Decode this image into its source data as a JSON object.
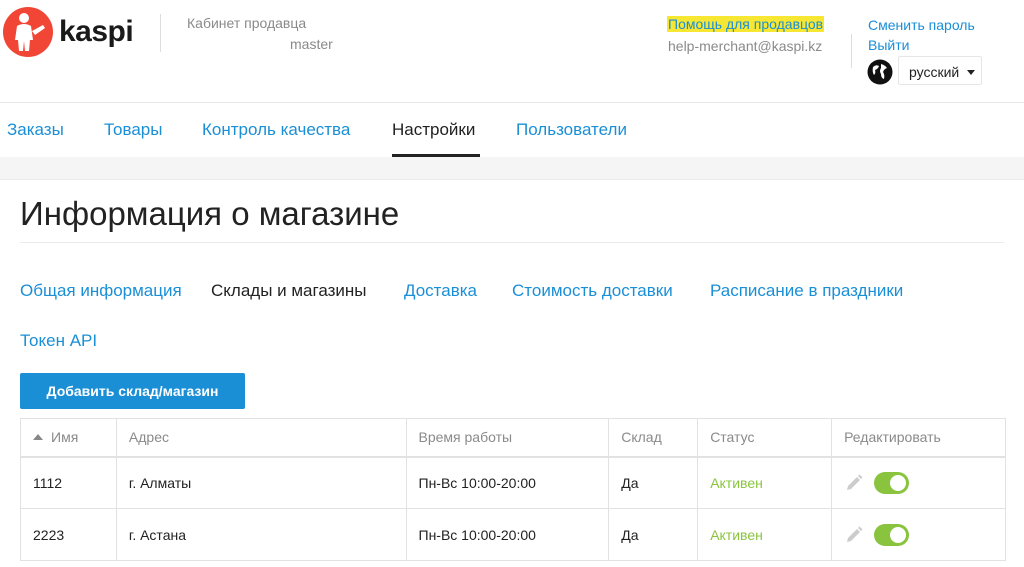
{
  "brand": {
    "name": "kaspi",
    "accent": "#f14635",
    "link_color": "#1a8fd6",
    "active_status_color": "#8ac43f"
  },
  "header": {
    "cabinet_title": "Кабинет продавца",
    "cabinet_user": "master",
    "help_link": "Помощь для продавцов",
    "help_email": "help-merchant@kaspi.kz",
    "change_password": "Сменить пароль",
    "logout": "Выйти",
    "language": "русский",
    "globe_icon": "globe-icon"
  },
  "nav": {
    "items": [
      {
        "label": "Заказы"
      },
      {
        "label": "Товары"
      },
      {
        "label": "Контроль качества"
      },
      {
        "label": "Настройки"
      },
      {
        "label": "Пользователи"
      }
    ],
    "active": "Настройки"
  },
  "page": {
    "title": "Информация о магазине",
    "subtabs": [
      {
        "label": "Общая информация"
      },
      {
        "label": "Склады и магазины"
      },
      {
        "label": "Доставка"
      },
      {
        "label": "Стоимость доставки"
      },
      {
        "label": "Расписание в праздники"
      },
      {
        "label": "Токен API"
      }
    ],
    "active_subtab": "Склады и магазины",
    "add_button": "Добавить склад/магазин"
  },
  "table": {
    "columns": [
      "Имя",
      "Адрес",
      "Время работы",
      "Склад",
      "Статус",
      "Редактировать"
    ],
    "sort_column": "Имя",
    "rows": [
      {
        "name": "1112",
        "address": "г. Алматы",
        "hours": "Пн-Вс 10:00-20:00",
        "warehouse": "Да",
        "status": "Активен",
        "enabled": true
      },
      {
        "name": "2223",
        "address": "г. Астана",
        "hours": "Пн-Вс 10:00-20:00",
        "warehouse": "Да",
        "status": "Активен",
        "enabled": true
      }
    ]
  }
}
